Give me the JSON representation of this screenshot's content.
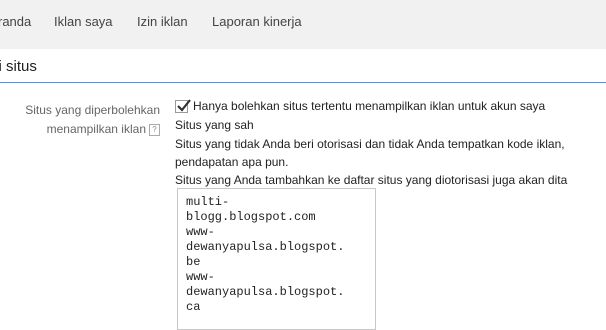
{
  "nav": {
    "items": [
      "randa",
      "Iklan saya",
      "Izin iklan",
      "Laporan kinerja"
    ]
  },
  "section": {
    "title": "si situs"
  },
  "settings": {
    "label_line1": "Situs yang diperbolehkan",
    "label_line2": "menampilkan iklan",
    "help_icon_glyph": "?",
    "checkbox_checked": true,
    "checkbox_label": "Hanya bolehkan situs tertentu menampilkan iklan untuk akun saya",
    "valid_sites_heading": "Situs yang sah",
    "desc_line1": "Situs yang tidak Anda beri otorisasi dan tidak Anda tempatkan kode iklan,",
    "desc_line2": "pendapatan apa pun.",
    "desc_line3": "Situs yang Anda tambahkan ke daftar situs yang diotorisasi juga akan dita",
    "sites_lines": [
      "multi-",
      "blogg.blogspot.com",
      "www-",
      "dewanyapulsa.blogspot.",
      "be",
      "www-",
      "dewanyapulsa.blogspot.",
      "ca"
    ]
  },
  "colors": {
    "nav_bg": "#f1f1f1",
    "accent_underline": "#4d90fe"
  }
}
